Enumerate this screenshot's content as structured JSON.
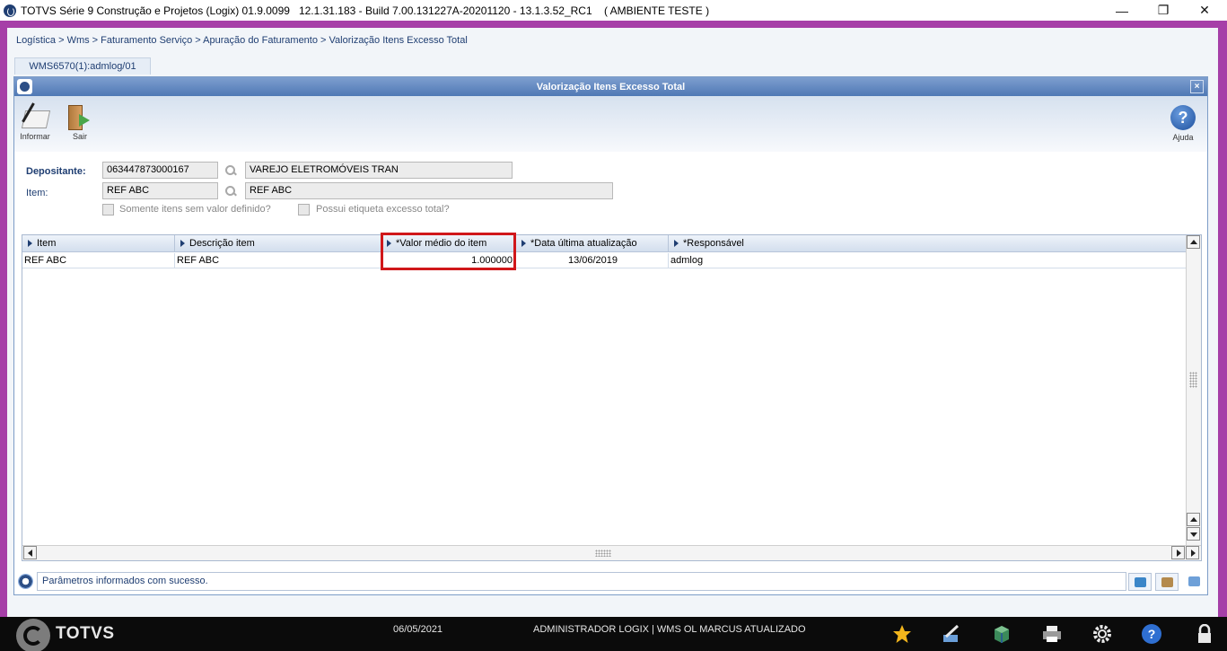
{
  "window": {
    "title": "TOTVS Série 9 Construção e Projetos (Logix) 01.9.0099   12.1.31.183 - Build 7.00.131227A-20201120 - 13.1.3.52_RC1    ( AMBIENTE TESTE )",
    "minimize": "—",
    "maximize": "❐",
    "close": "✕"
  },
  "breadcrumb": "Logística > Wms > Faturamento Serviço > Apuração do Faturamento > Valorização Itens Excesso Total",
  "tab": "WMS6570(1):admlog/01",
  "form": {
    "title": "Valorização Itens Excesso Total",
    "close": "×",
    "toolbar": {
      "informar": "Informar",
      "sair": "Sair",
      "ajuda": "Ajuda"
    },
    "fields": {
      "depositante_label": "Depositante:",
      "depositante_code": "063447873000167",
      "depositante_name": "VAREJO ELETROMÓVEIS TRAN",
      "item_label": "Item:",
      "item_code": "REF ABC",
      "item_desc": "REF ABC",
      "check1": "Somente itens sem valor definido?",
      "check2": "Possui etiqueta excesso total?"
    }
  },
  "grid": {
    "columns": [
      "Item",
      "Descrição item",
      "*Valor médio do item",
      "*Data última atualização",
      "*Responsável"
    ],
    "rows": [
      [
        "REF ABC",
        "REF ABC",
        "1.000000",
        "13/06/2019",
        "admlog"
      ]
    ]
  },
  "status": {
    "message": "Parâmetros informados com sucesso."
  },
  "taskbar": {
    "brand": "TOTVS",
    "date": "06/05/2021",
    "user": "ADMINISTRADOR LOGIX | WMS OL MARCUS ATUALIZADO",
    "help": "?"
  },
  "colors": {
    "frame": "#a63fa8",
    "header_blue": "#4f78b5",
    "highlight": "#d0171a",
    "taskbar": "#0b0b0b"
  },
  "icons": [
    "app-icon",
    "informar-icon",
    "sair-icon",
    "help-icon",
    "search-icon",
    "star-icon",
    "pen-icon",
    "box-icon",
    "printer-icon",
    "gear-icon",
    "lock-icon"
  ]
}
